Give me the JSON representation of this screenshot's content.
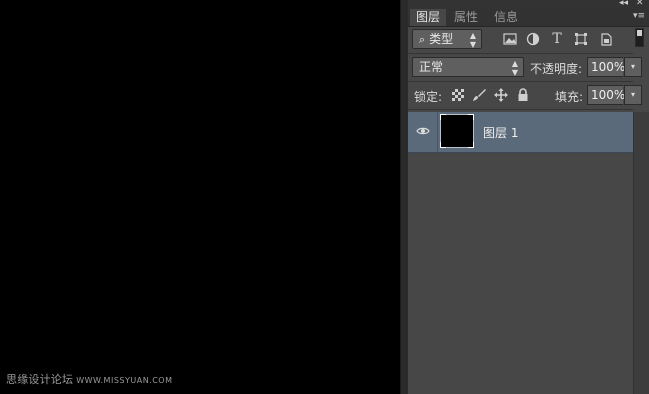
{
  "watermark": {
    "text": "思缘设计论坛",
    "url": "WWW.MISSYUAN.COM"
  },
  "window_controls": {
    "collapse": "◂◂",
    "close": "✕"
  },
  "tabs": [
    {
      "label": "图层",
      "active": true
    },
    {
      "label": "属性",
      "active": false
    },
    {
      "label": "信息",
      "active": false
    }
  ],
  "tab_menu": "▾≡",
  "filter": {
    "search_glyph": "⌕",
    "kind_label": "类型",
    "arrows": "▲▼",
    "icons": [
      "image-filter-icon",
      "adjustment-filter-icon",
      "type-filter-icon",
      "shape-filter-icon",
      "smart-object-filter-icon"
    ],
    "type_glyph": "T"
  },
  "blend": {
    "mode": "正常",
    "arrows": "▲▼",
    "opacity_label": "不透明度:",
    "opacity_value": "100%",
    "dropdown_arrow": "▾"
  },
  "lock": {
    "label": "锁定:",
    "fill_label": "填充:",
    "fill_value": "100%",
    "dropdown_arrow": "▾"
  },
  "layers": [
    {
      "name": "图层 1",
      "visible": true,
      "selected": true
    }
  ],
  "colors": {
    "panel": "#474747",
    "selected_layer": "#5b6a7a",
    "canvas": "#000000"
  }
}
